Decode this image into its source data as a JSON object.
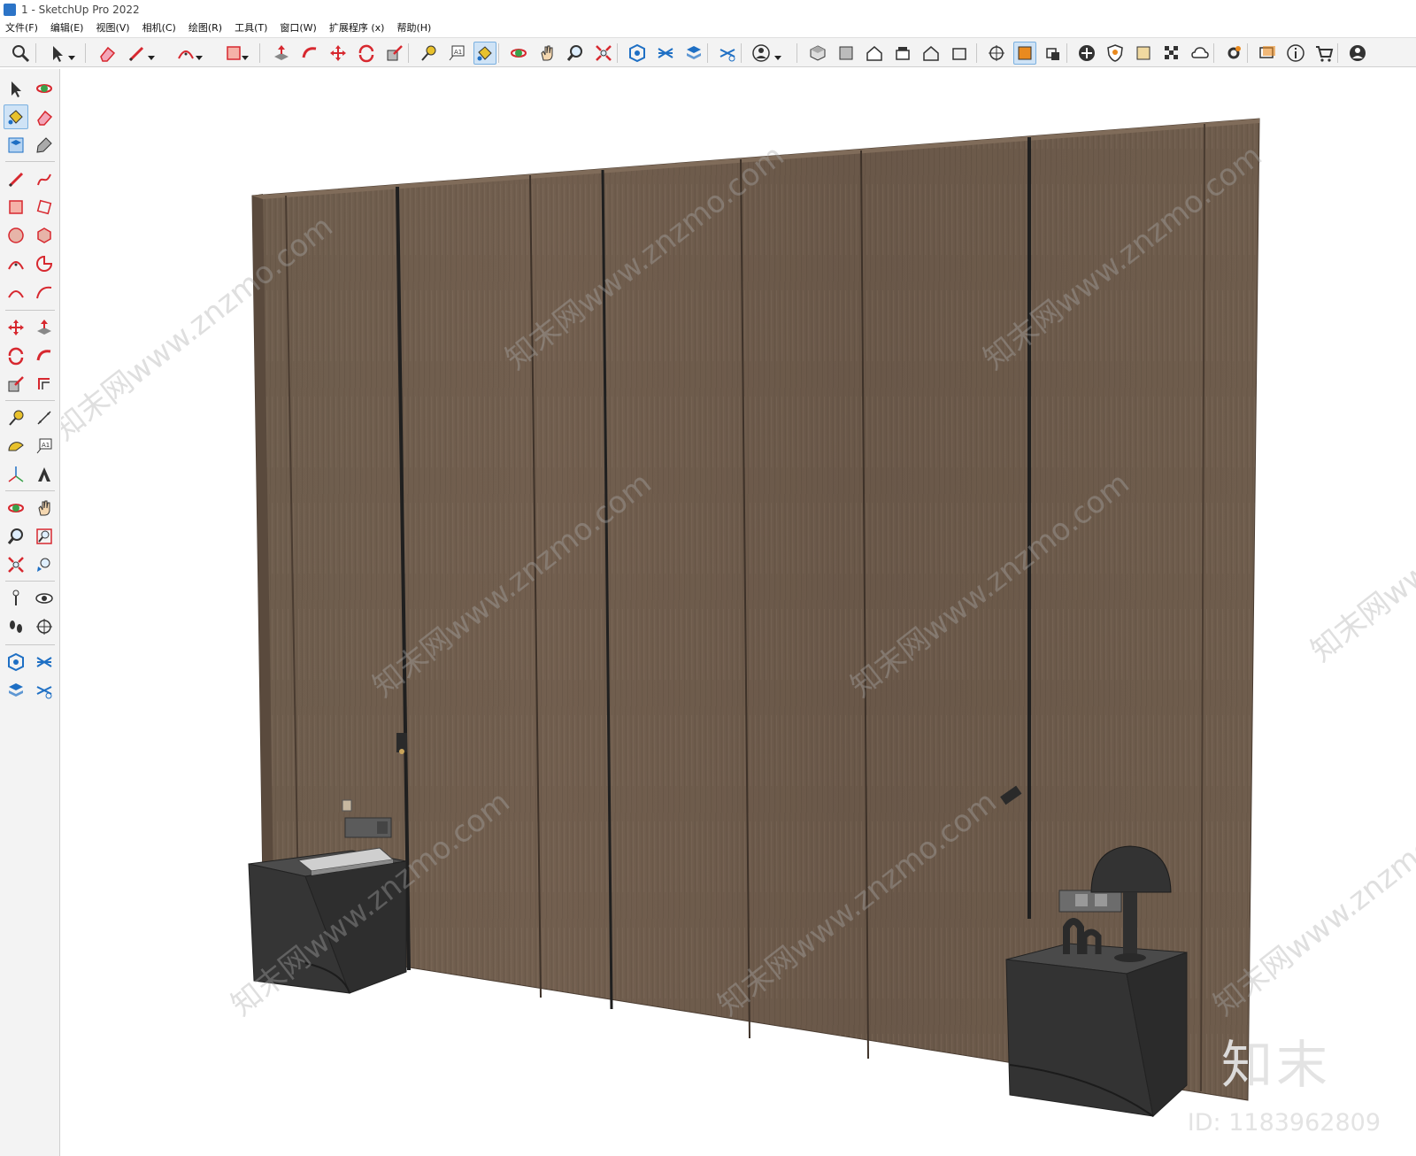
{
  "window": {
    "title": "1 - SketchUp Pro 2022"
  },
  "menu": [
    "文件(F)",
    "编辑(E)",
    "视图(V)",
    "相机(C)",
    "绘图(R)",
    "工具(T)",
    "窗口(W)",
    "扩展程序 (x)",
    "帮助(H)"
  ],
  "toolbar_icons": [
    "search-icon",
    "select-arrow-icon",
    "eraser-icon",
    "pencil-icon",
    "arc-icon",
    "rectangle-icon",
    "push-pull-icon",
    "follow-me-icon",
    "move-icon",
    "rotate-icon",
    "scale-icon",
    "tape-measure-icon",
    "text-icon",
    "paint-bucket-icon",
    "orbit-icon",
    "pan-icon",
    "zoom-icon",
    "zoom-extents-icon",
    "warehouse-icon",
    "extension-warehouse-icon",
    "layout-icon",
    "sandbox-icon",
    "user-icon",
    "iso-view-icon",
    "top-view-icon",
    "front-view-icon",
    "right-view-icon",
    "back-view-icon",
    "left-view-icon",
    "section-plane-icon",
    "section-fill-icon",
    "display-section-icon",
    "add-icon",
    "shield-icon",
    "style-icon",
    "pattern-icon",
    "cloud-icon",
    "settings-icon",
    "message-icon",
    "info-icon",
    "cart-icon",
    "account-icon"
  ],
  "left_icons": [
    "select-icon",
    "orbit-icon",
    "paint-bucket-icon",
    "eraser-icon",
    "component-icon",
    "tag-icon",
    "pencil-icon",
    "freehand-icon",
    "rectangle-icon",
    "rotated-rectangle-icon",
    "circle-icon",
    "polygon-icon",
    "arc-icon",
    "pie-icon",
    "two-point-arc-icon",
    "three-point-arc-icon",
    "move-icon",
    "push-pull-icon",
    "rotate-icon",
    "follow-me-icon",
    "scale-icon",
    "offset-icon",
    "tape-measure-icon",
    "dimension-icon",
    "protractor-icon",
    "text-icon",
    "axes-icon",
    "3d-text-icon",
    "orbit2-icon",
    "pan-icon",
    "zoom-icon",
    "zoom-window-icon",
    "zoom-extents-icon",
    "previous-view-icon",
    "position-camera-icon",
    "look-around-icon",
    "walk-icon",
    "section-plane-icon",
    "warehouse-icon",
    "extension-warehouse-icon",
    "layout-icon",
    "sandbox-icon"
  ],
  "watermark": {
    "site": "知末网www.znzmo.com",
    "brand": "知末",
    "id": "ID: 1183962809"
  },
  "colors": {
    "wood": "#6b5a4b",
    "groove": "#3a302a",
    "cabinet": "#3a3a3a",
    "accent": "#2c74c7"
  }
}
